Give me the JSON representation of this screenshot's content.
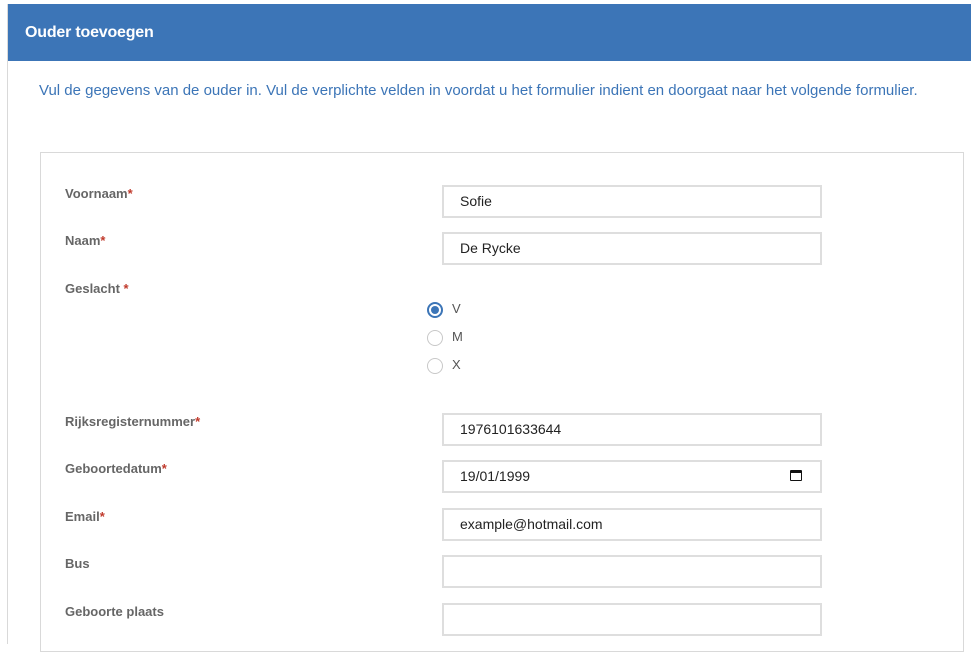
{
  "header": {
    "title": "Ouder toevoegen"
  },
  "intro": "Vul de gegevens van de ouder in. Vul de verplichte velden in voordat u het formulier indient en doorgaat naar het volgende formulier.",
  "colors": {
    "accent": "#3c75b7",
    "required": "#c0392b"
  },
  "form": {
    "voornaam": {
      "label": "Voornaam",
      "required_mark": "*",
      "value": "Sofie"
    },
    "naam": {
      "label": "Naam",
      "required_mark": "*",
      "value": "De Rycke"
    },
    "geslacht": {
      "label": "Geslacht ",
      "required_mark": "*",
      "options": [
        "V",
        "M",
        "X"
      ],
      "selected": "V"
    },
    "rijksregisternummer": {
      "label": "Rijksregisternummer",
      "required_mark": "*",
      "value": "1976101633644"
    },
    "geboortedatum": {
      "label": "Geboortedatum",
      "required_mark": "*",
      "value": "19/01/1999",
      "icon": "calendar-icon"
    },
    "email": {
      "label": "Email",
      "required_mark": "*",
      "value": "example@hotmail.com"
    },
    "bus": {
      "label": "Bus",
      "value": ""
    },
    "geboorte_plaats": {
      "label": "Geboorte plaats",
      "value": ""
    }
  }
}
